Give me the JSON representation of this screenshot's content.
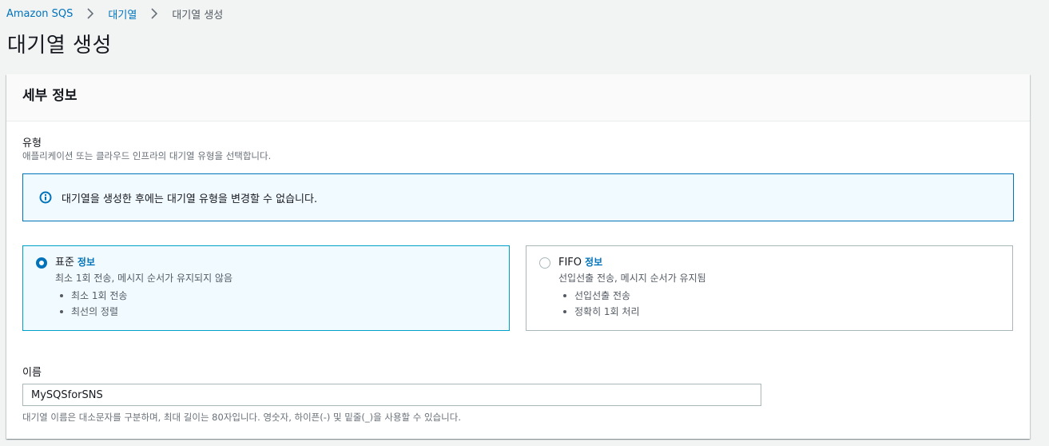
{
  "breadcrumb": {
    "items": [
      {
        "label": "Amazon SQS"
      },
      {
        "label": "대기열"
      },
      {
        "label": "대기열 생성"
      }
    ]
  },
  "page": {
    "title": "대기열 생성"
  },
  "details": {
    "title": "세부 정보",
    "type": {
      "label": "유형",
      "description": "애플리케이션 또는 클라우드 인프라의 대기열 유형을 선택합니다.",
      "alert": "대기열을 생성한 후에는 대기열 유형을 변경할 수 없습니다.",
      "options": [
        {
          "name": "표준",
          "info": "정보",
          "description": "최소 1회 전송, 메시지 순서가 유지되지 않음",
          "features": [
            "최소 1회 전송",
            "최선의 정렬"
          ],
          "selected": true
        },
        {
          "name": "FIFO",
          "info": "정보",
          "description": "선입선출 전송, 메시지 순서가 유지됨",
          "features": [
            "선입선출 전송",
            "정확히 1회 처리"
          ],
          "selected": false
        }
      ]
    },
    "name": {
      "label": "이름",
      "value": "MySQSforSNS",
      "constraint": "대기열 이름은 대소문자를 구분하며, 최대 길이는 80자입니다. 영숫자, 하이픈(-) 및 밑줄(_)을 사용할 수 있습니다."
    }
  },
  "colors": {
    "link": "#0073bb",
    "selected_border": "#00a1c9",
    "selected_bg": "#f1faff"
  },
  "icons": {
    "info": "info-circle-icon",
    "separator": "chevron-right-icon"
  }
}
